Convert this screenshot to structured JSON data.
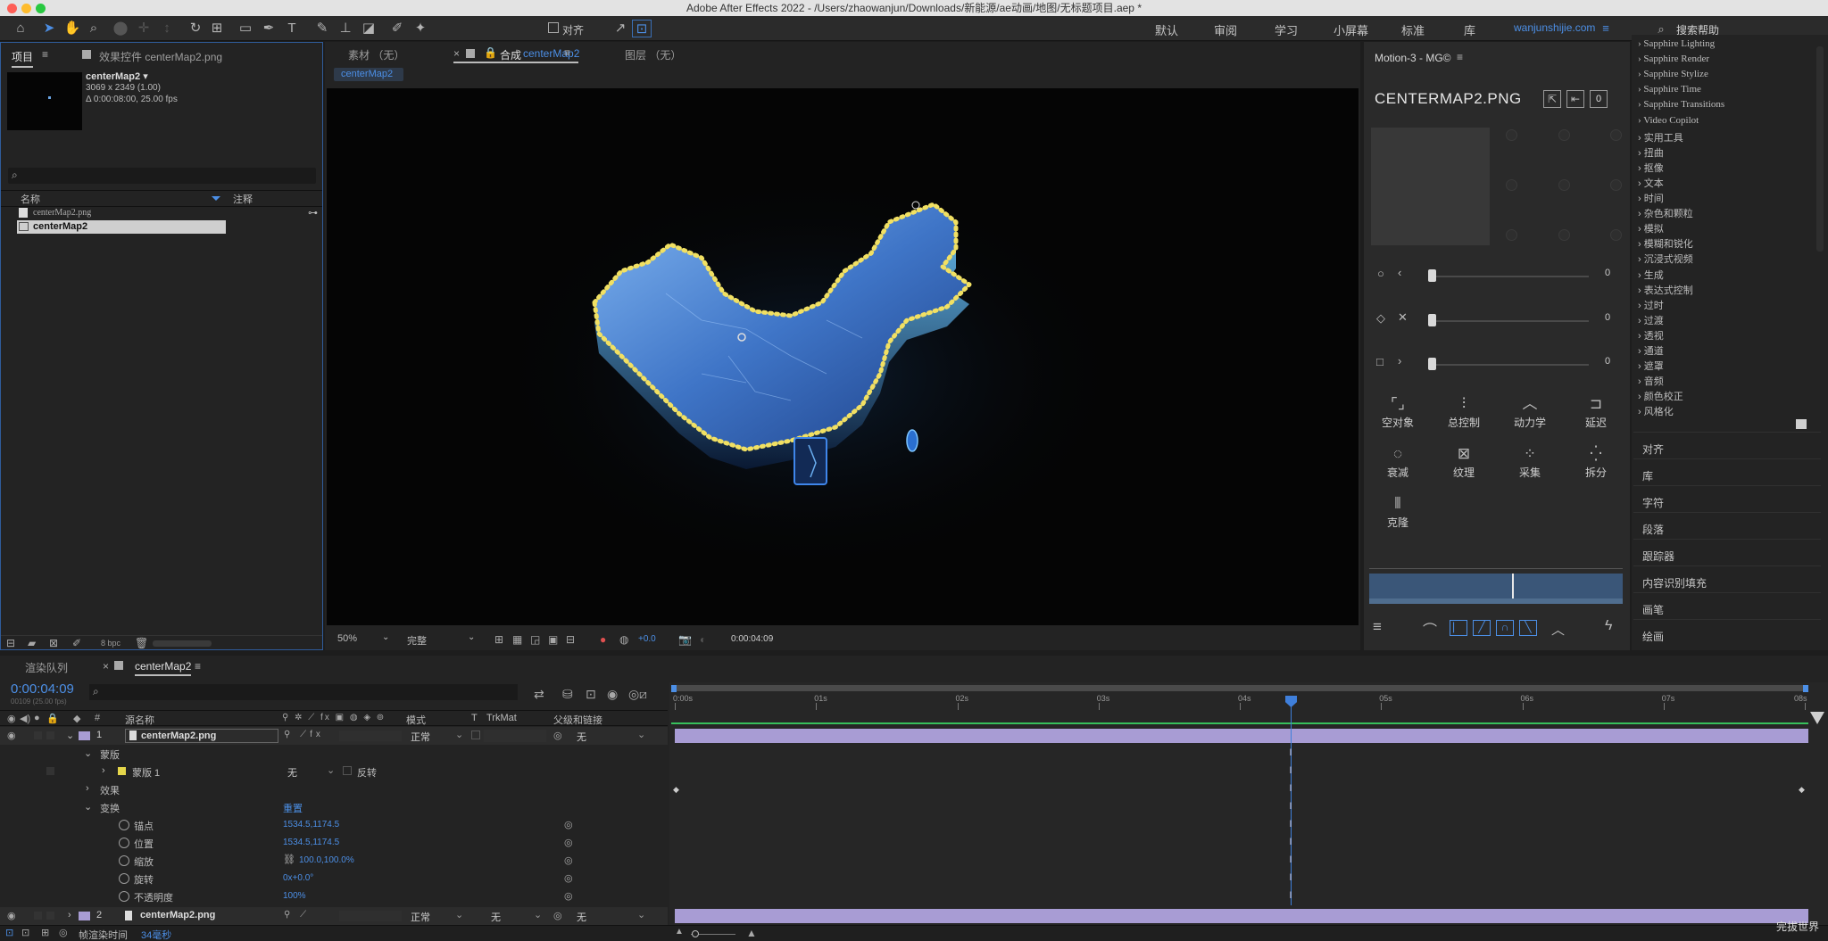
{
  "titlebar": {
    "title": "Adobe After Effects 2022 - /Users/zhaowanjun/Downloads/新能源/ae动画/地图/无标题项目.aep *"
  },
  "toolbar": {
    "align_label": "对齐",
    "workspaces": [
      "默认",
      "审阅",
      "学习",
      "小屏幕",
      "标准",
      "库"
    ],
    "user": "wanjunshijie.com",
    "search_placeholder": "搜索帮助"
  },
  "project_panel": {
    "tab_project": "项目",
    "tab_effects": "效果控件 centerMap2.png",
    "item_name": "centerMap2 ▾",
    "item_size": "3069 x 2349 (1.00)",
    "item_duration": "Δ 0:00:08:00, 25.00 fps",
    "col_name": "名称",
    "col_comment": "注释",
    "items": [
      "centerMap2.png",
      "centerMap2"
    ],
    "bpc": "8 bpc"
  },
  "comp_panel": {
    "tab_footage": "素材 （无）",
    "tab_comp_prefix": "合成",
    "tab_comp_name": "centerMap2",
    "tab_layer": "图层 （无）",
    "breadcrumb": "centerMap2",
    "zoom": "50%",
    "resolution": "完整",
    "exposure": "+0.0",
    "timecode": "0:00:04:09"
  },
  "motion_panel": {
    "title": "Motion-3 - MG©",
    "asset": "CENTERMAP2.PNG",
    "counter": "0",
    "slider_values": [
      "0",
      "0",
      "0"
    ],
    "buttons": [
      "空对象",
      "总控制",
      "动力学",
      "延迟",
      "衰减",
      "纹理",
      "采集",
      "拆分",
      "克隆"
    ]
  },
  "effects_list": [
    "Sapphire Lighting",
    "Sapphire Render",
    "Sapphire Stylize",
    "Sapphire Time",
    "Sapphire Transitions",
    "Video Copilot",
    "实用工具",
    "扭曲",
    "抠像",
    "文本",
    "时间",
    "杂色和颗粒",
    "模拟",
    "模糊和锐化",
    "沉浸式视频",
    "生成",
    "表达式控制",
    "过时",
    "过渡",
    "透视",
    "通道",
    "遮罩",
    "音频",
    "颜色校正",
    "风格化"
  ],
  "right_panels": [
    "对齐",
    "库",
    "字符",
    "段落",
    "跟踪器",
    "内容识别填充",
    "画笔",
    "绘画"
  ],
  "timeline": {
    "tab_render": "渲染队列",
    "tab_comp": "centerMap2",
    "timecode": "0:00:04:09",
    "frames": "00109 (25.00 fps)",
    "col_source": "源名称",
    "col_mode": "模式",
    "col_t": "T",
    "col_trkmat": "TrkMat",
    "col_parent": "父级和链接",
    "layers": [
      {
        "num": "1",
        "name": "centerMap2.png",
        "mode": "正常",
        "trkmat": "",
        "parent": "无"
      },
      {
        "num": "2",
        "name": "centerMap2.png",
        "mode": "正常",
        "trkmat": "无",
        "parent": "无"
      }
    ],
    "masks_label": "蒙版",
    "mask1_label": "蒙版 1",
    "mask1_mode": "无",
    "mask1_invert": "反转",
    "effects_label": "效果",
    "transform_label": "变换",
    "reset": "重置",
    "props": [
      {
        "name": "锚点",
        "value": "1534.5,1174.5"
      },
      {
        "name": "位置",
        "value": "1534.5,1174.5"
      },
      {
        "name": "缩放",
        "value": "100.0,100.0%"
      },
      {
        "name": "旋转",
        "value": "0x+0.0°"
      },
      {
        "name": "不透明度",
        "value": "100%"
      }
    ],
    "ruler": [
      "0:00s",
      "01s",
      "02s",
      "03s",
      "04s",
      "05s",
      "06s",
      "07s",
      "08s"
    ],
    "render_time_label": "帧渲染时间",
    "render_time": "34毫秒"
  },
  "watermark": "完拔世界"
}
